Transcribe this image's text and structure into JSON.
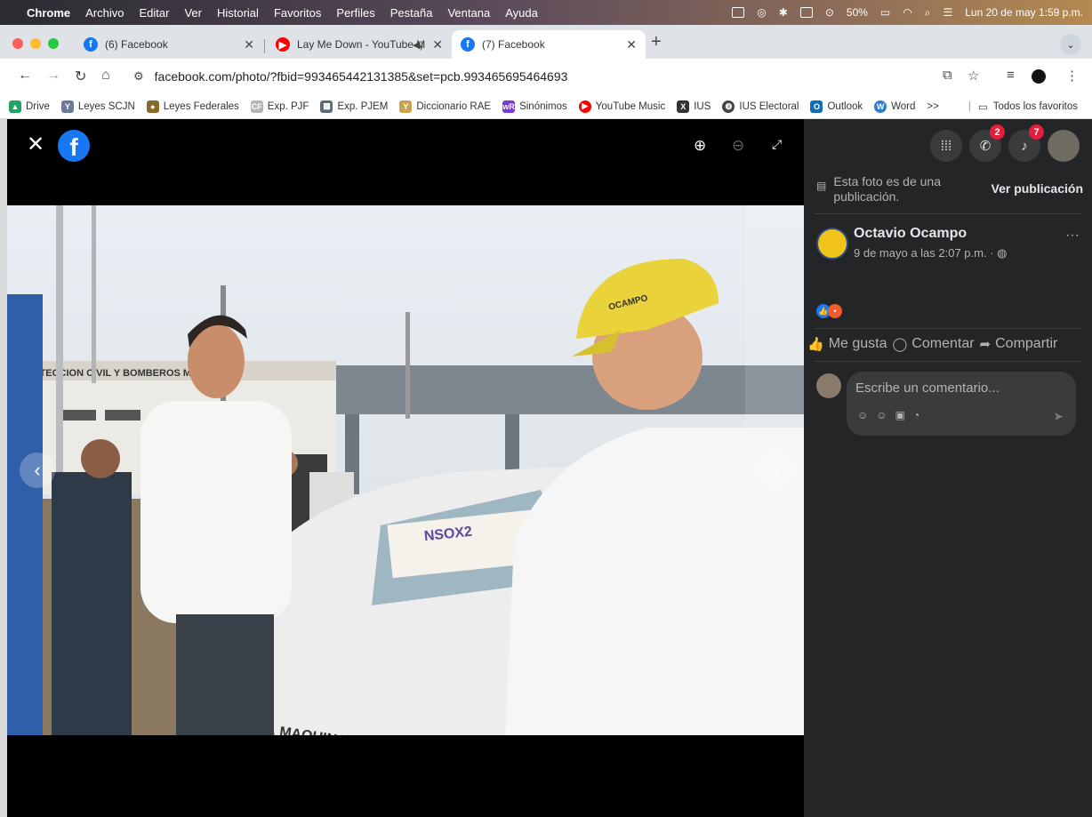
{
  "menubar": {
    "app": "Chrome",
    "items": [
      "Archivo",
      "Editar",
      "Ver",
      "Historial",
      "Favoritos",
      "Perfiles",
      "Pestaña",
      "Ventana",
      "Ayuda"
    ],
    "battery": "50%",
    "clock": "Lun 20 de may  1:59 p.m."
  },
  "tabs": [
    {
      "title": "(6) Facebook",
      "icon": "facebook-icon"
    },
    {
      "title": "Lay Me Down - YouTube M",
      "icon": "youtube-music-icon"
    },
    {
      "title": "(7) Facebook",
      "icon": "facebook-icon"
    }
  ],
  "toolbar": {
    "url": "facebook.com/photo/?fbid=993465442131385&set=pcb.993465695464693"
  },
  "bookmarks": {
    "items": [
      "Drive",
      "Leyes SCJN",
      "Leyes Federales",
      "Exp. PJF",
      "Exp. PJEM",
      "Diccionario RAE",
      "Sinónimos",
      "YouTube Music",
      "IUS",
      "IUS Electoral",
      "Outlook",
      "Word"
    ],
    "overflow": ">>",
    "all_label": "Todos los favoritos"
  },
  "photo": {
    "sign_text": "OTECCION CIVIL Y BOMBEROS MUNI",
    "poster_text": "NSOX2",
    "car_text": "R. T. MAQUINAS RO",
    "cap_text": "OCAMPO"
  },
  "side": {
    "messenger_badge": "2",
    "notifications_badge": "7",
    "notice_text": "Esta foto es de una publicación.",
    "notice_link": "Ver publicación",
    "author_name": "Octavio Ocampo",
    "post_date": "9 de mayo a las 2:07 p.m. ·",
    "more": "···",
    "like_label": "Me gusta",
    "comment_label": "Comentar",
    "share_label": "Compartir",
    "comment_placeholder": "Escribe un comentario..."
  },
  "colors": {
    "facebook_blue": "#1877f2",
    "side_panel_bg": "#242526",
    "badge_red": "#e41e3f",
    "comment_box_bg": "#3a3b3c"
  }
}
